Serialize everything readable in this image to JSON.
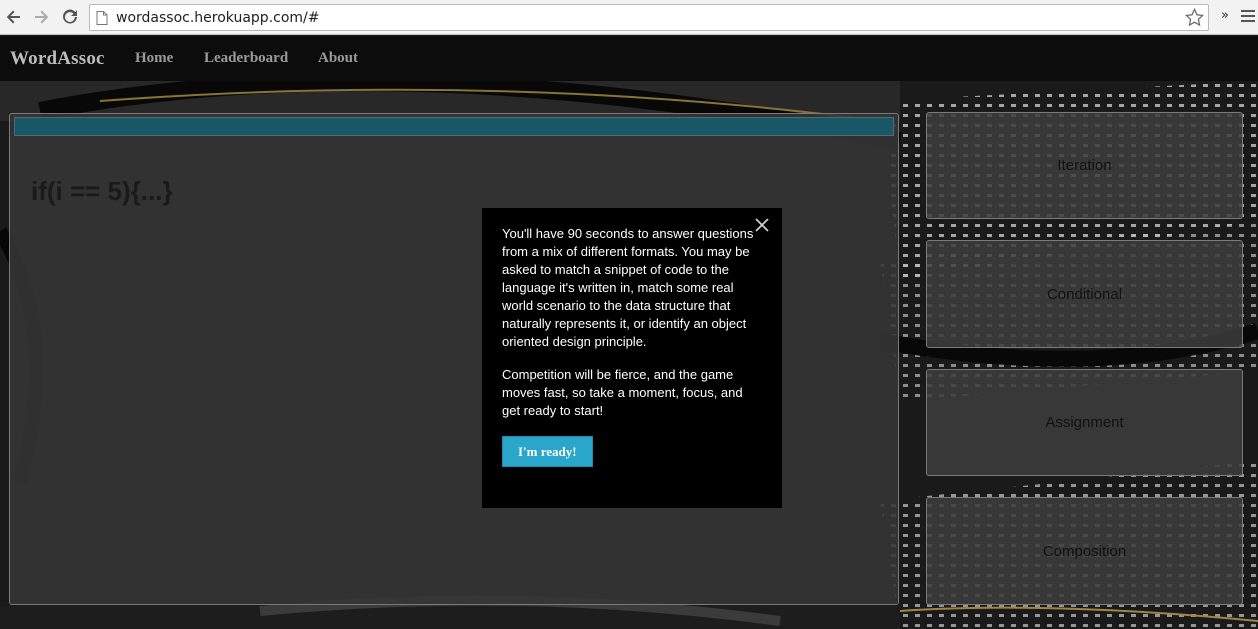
{
  "browser": {
    "url": "wordassoc.herokuapp.com/#",
    "overflow_label": "»"
  },
  "navbar": {
    "brand": "WordAssoc",
    "links": [
      "Home",
      "Leaderboard",
      "About"
    ]
  },
  "question": {
    "prompt": "if(i == 5){...}",
    "progress_fraction": 1.0
  },
  "answers": [
    "Iteration",
    "Conditional",
    "Assignment",
    "Composition"
  ],
  "modal": {
    "paragraph1": "You'll have 90 seconds to answer questions from a mix of different formats. You may be asked to match a snippet of code to the language it's written in, match some real world scenario to the data structure that naturally represents it, or identify an object oriented design principle.",
    "paragraph2": "Competition will be fierce, and the game moves fast, so take a moment, focus, and get ready to start!",
    "button_label": "I'm ready!"
  },
  "colors": {
    "progress_fill": "#1d6375",
    "button": "#2ba6cb",
    "navbar": "#0c0c0c"
  }
}
